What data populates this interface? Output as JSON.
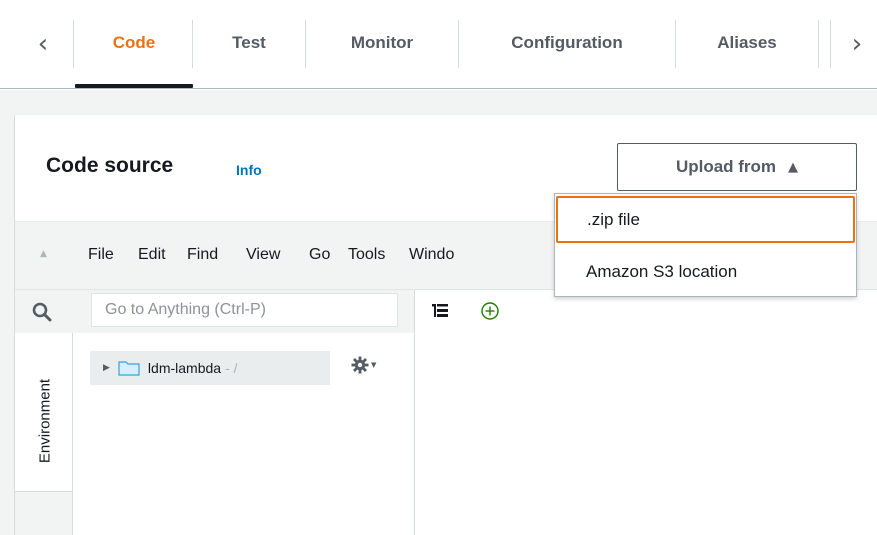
{
  "tabs": {
    "prev_icon": "chevron-left",
    "next_icon": "chevron-right",
    "items": [
      {
        "label": "Code",
        "active": true
      },
      {
        "label": "Test"
      },
      {
        "label": "Monitor"
      },
      {
        "label": "Configuration"
      },
      {
        "label": "Aliases"
      }
    ]
  },
  "code_source": {
    "title": "Code source",
    "info_link": "Info",
    "upload_button": "Upload from",
    "upload_menu": [
      ".zip file",
      "Amazon S3 location"
    ]
  },
  "ide": {
    "menu": [
      "File",
      "Edit",
      "Find",
      "View",
      "Go",
      "Tools",
      "Windo"
    ],
    "search_placeholder": "Go to Anything (Ctrl-P)",
    "environment_label": "Environment",
    "tree": {
      "folder_name": "ldm-lambda",
      "folder_path": "- /"
    }
  },
  "colors": {
    "accent": "#ec7211",
    "link": "#0073bb",
    "text": "#16191f",
    "muted": "#545b64",
    "add_green": "#1d8102"
  }
}
